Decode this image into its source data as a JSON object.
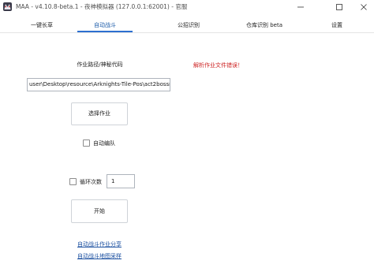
{
  "window": {
    "title": "MAA - v4.10.8-beta.1 - 夜神模拟器 (127.0.0.1:62001) - 官服",
    "icon": "maa-app-icon",
    "controls": [
      "minimize-icon",
      "maximize-icon",
      "close-icon"
    ]
  },
  "tabs": [
    {
      "label": "一键长草"
    },
    {
      "label": "自动战斗",
      "active": true
    },
    {
      "label": "公招识别"
    },
    {
      "label": "仓库识别 beta"
    },
    {
      "label": "设置"
    }
  ],
  "copilot": {
    "path_label": "作业路径/神秘代码",
    "error_message": "解析作业文件错误！",
    "path_value": "user\\Desktop\\resource\\Arknights-Tile-Pos\\act2bossrush",
    "select_button": "选择作业",
    "auto_squad": {
      "label": "自动编队",
      "checked": false
    },
    "loop": {
      "label": "循环次数",
      "checked": false,
      "times": "1"
    },
    "start_button": "开始",
    "links": {
      "share": "自动战斗作业分享",
      "map": "自动战斗地图采样"
    }
  },
  "colors": {
    "accent": "#2d6fd0",
    "error": "#cc1f1f",
    "link": "#1a4fa0"
  }
}
